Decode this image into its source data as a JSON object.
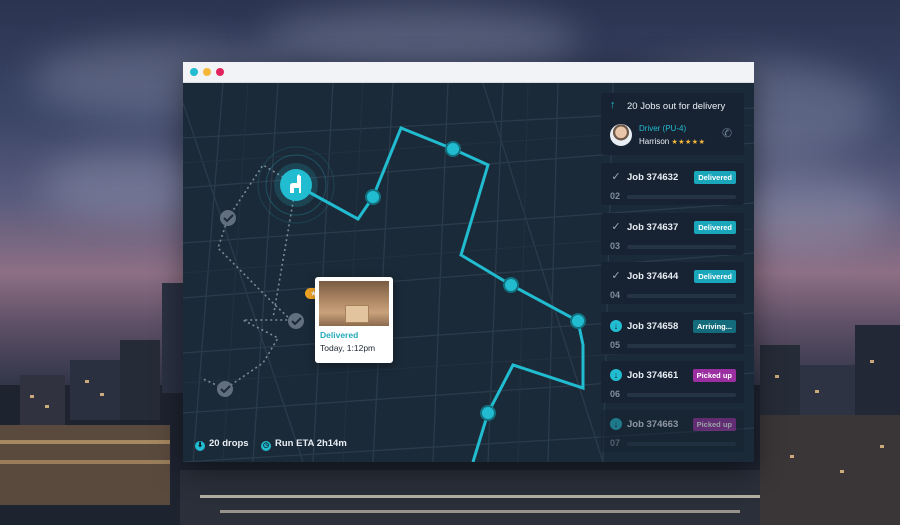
{
  "window": {
    "traffic_lights": [
      "#21bcd0",
      "#f4b73a",
      "#e0245e"
    ]
  },
  "map": {
    "brand_icon": "llama-icon",
    "route_color": "#21bcd0",
    "delivered_popup": {
      "rating": "★★★★★",
      "status": "Delivered",
      "time": "Today, 1:12pm"
    },
    "footer": {
      "drops": "20 drops",
      "eta": "Run ETA 2h14m"
    }
  },
  "panel": {
    "header_title": "20 Jobs out for delivery",
    "driver_role": "Driver (PU-4)",
    "driver_name": "Harrison",
    "driver_rating": "★★★★★",
    "jobs": [
      {
        "name": "Job 374632",
        "seq": "02",
        "status": "Delivered",
        "status_color": "#1aa6bb",
        "icon": "check-icon"
      },
      {
        "name": "Job 374637",
        "seq": "03",
        "status": "Delivered",
        "status_color": "#1aa6bb",
        "icon": "check-icon"
      },
      {
        "name": "Job 374644",
        "seq": "04",
        "status": "Delivered",
        "status_color": "#1aa6bb",
        "icon": "check-icon"
      },
      {
        "name": "Job 374658",
        "seq": "05",
        "status": "Arriving...",
        "status_color": "#146b7c",
        "icon": "arrow-down-icon"
      },
      {
        "name": "Job 374661",
        "seq": "06",
        "status": "Picked up",
        "status_color": "#9b2fa1",
        "icon": "arrow-down-icon"
      },
      {
        "name": "Job 374663",
        "seq": "07",
        "status": "Picked up",
        "status_color": "#9b2fa1",
        "icon": "arrow-down-icon"
      }
    ]
  }
}
